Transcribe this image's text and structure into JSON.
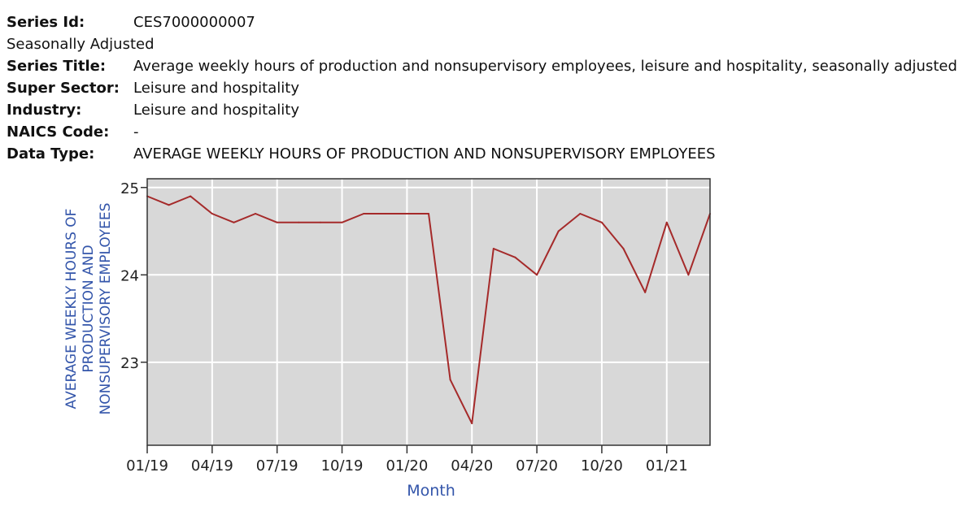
{
  "meta": {
    "series_id_label": "Series Id:",
    "series_id": "CES7000000007",
    "seasonal": "Seasonally Adjusted",
    "series_title_label": "Series Title:",
    "series_title": "Average weekly hours of production and nonsupervisory employees, leisure and hospitality, seasonally adjusted",
    "super_sector_label": "Super Sector:",
    "super_sector": "Leisure and hospitality",
    "industry_label": "Industry:",
    "industry": "Leisure and hospitality",
    "naics_label": "NAICS Code:",
    "naics": "-",
    "data_type_label": "Data Type:",
    "data_type": "AVERAGE WEEKLY HOURS OF PRODUCTION AND NONSUPERVISORY EMPLOYEES"
  },
  "chart_data": {
    "type": "line",
    "title": "",
    "xlabel": "Month",
    "ylabel_lines": [
      "AVERAGE WEEKLY HOURS OF",
      "PRODUCTION AND",
      "NONSUPERVISORY EMPLOYEES"
    ],
    "x": [
      "01/19",
      "02/19",
      "03/19",
      "04/19",
      "05/19",
      "06/19",
      "07/19",
      "08/19",
      "09/19",
      "10/19",
      "11/19",
      "12/19",
      "01/20",
      "02/20",
      "03/20",
      "04/20",
      "05/20",
      "06/20",
      "07/20",
      "08/20",
      "09/20",
      "10/20",
      "11/20",
      "12/20",
      "01/21",
      "02/21",
      "03/21"
    ],
    "series": [
      {
        "name": "Average weekly hours",
        "color": "#a52a2a",
        "values": [
          24.9,
          24.8,
          24.9,
          24.7,
          24.6,
          24.7,
          24.6,
          24.6,
          24.6,
          24.6,
          24.7,
          24.7,
          24.7,
          24.7,
          22.8,
          22.3,
          24.3,
          24.2,
          24.0,
          24.5,
          24.7,
          24.6,
          24.3,
          23.8,
          24.6,
          24.0,
          24.7
        ]
      }
    ],
    "x_ticks": [
      "01/19",
      "04/19",
      "07/19",
      "10/19",
      "01/20",
      "04/20",
      "07/20",
      "10/20",
      "01/21"
    ],
    "y_ticks": [
      23,
      24,
      25
    ],
    "ylim": [
      22.05,
      25.1
    ],
    "grid": true,
    "colors": {
      "plot_bg": "#d8d8d8",
      "grid": "#ffffff",
      "axis_label": "#3355aa",
      "line": "#a52a2a"
    }
  }
}
